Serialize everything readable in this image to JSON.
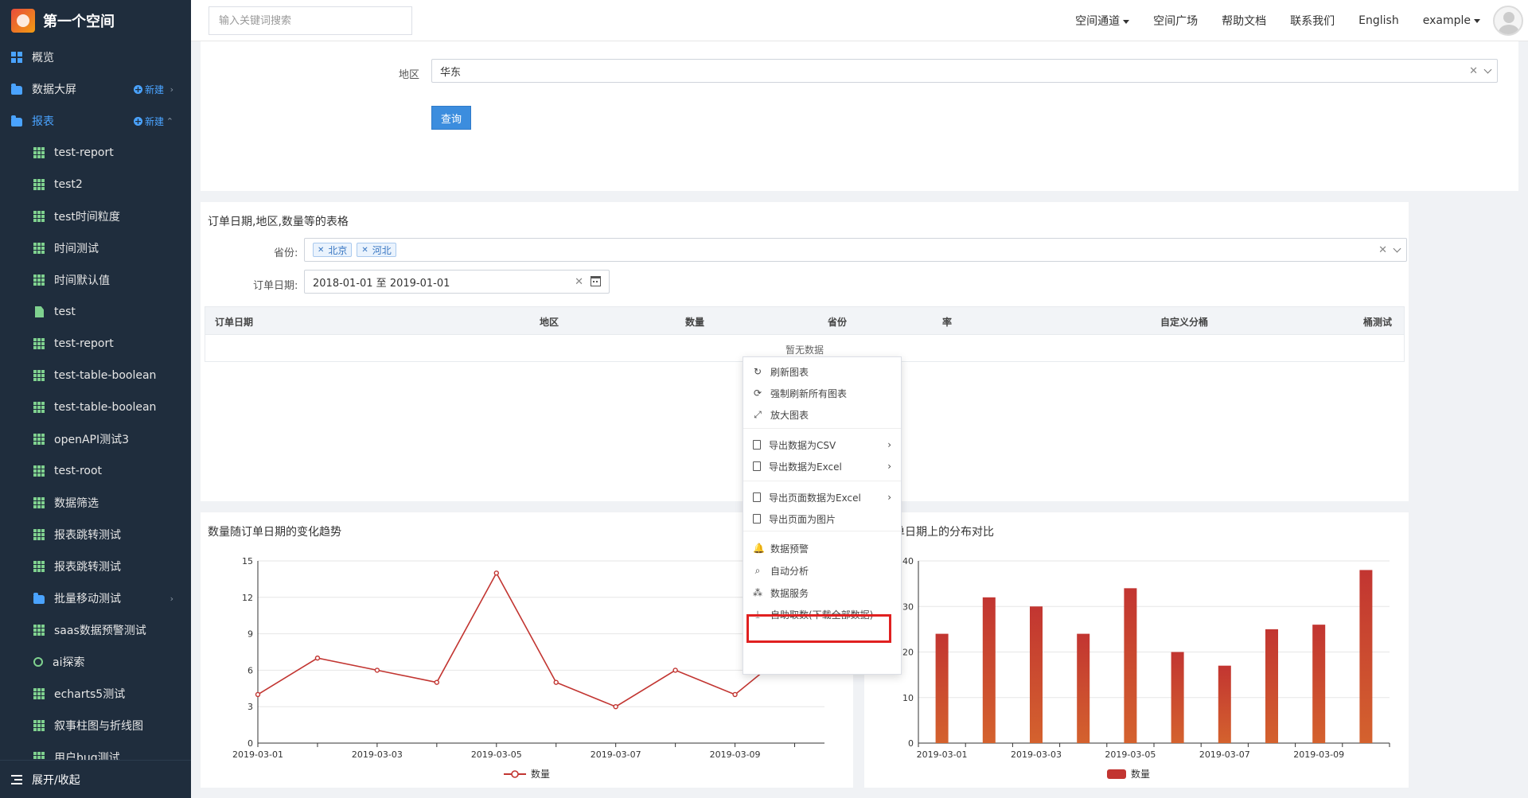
{
  "app": {
    "title": "第一个空间"
  },
  "sidebar": {
    "items": [
      {
        "label": "概览",
        "icon": "dashboard-icon",
        "level": 0
      },
      {
        "label": "数据大屏",
        "icon": "folder-icon",
        "level": 0,
        "new_label": "新建"
      },
      {
        "label": "报表",
        "icon": "folder-icon",
        "level": 0,
        "new_label": "新建",
        "active": true
      },
      {
        "label": "test-report",
        "icon": "table-icon",
        "level": 1
      },
      {
        "label": "test2",
        "icon": "table-icon",
        "level": 1
      },
      {
        "label": "test时间粒度",
        "icon": "table-icon",
        "level": 1
      },
      {
        "label": "时间测试",
        "icon": "table-icon",
        "level": 1
      },
      {
        "label": "时间默认值",
        "icon": "table-icon",
        "level": 1
      },
      {
        "label": "test",
        "icon": "file-icon",
        "level": 1
      },
      {
        "label": "test-report",
        "icon": "table-icon",
        "level": 1
      },
      {
        "label": "test-table-boolean",
        "icon": "table-icon",
        "level": 1
      },
      {
        "label": "test-table-boolean",
        "icon": "table-icon",
        "level": 1
      },
      {
        "label": "openAPI测试3",
        "icon": "table-icon",
        "level": 1
      },
      {
        "label": "test-root",
        "icon": "table-icon",
        "level": 1
      },
      {
        "label": "数据筛选",
        "icon": "table-icon",
        "level": 1
      },
      {
        "label": "报表跳转测试",
        "icon": "table-icon",
        "level": 1
      },
      {
        "label": "报表跳转测试",
        "icon": "table-icon",
        "level": 1
      },
      {
        "label": "批量移动测试",
        "icon": "folder-icon",
        "level": 1
      },
      {
        "label": "saas数据预警测试",
        "icon": "table-icon",
        "level": 1
      },
      {
        "label": "ai探索",
        "icon": "ai-icon",
        "level": 1
      },
      {
        "label": "echarts5测试",
        "icon": "table-icon",
        "level": 1
      },
      {
        "label": "叙事柱图与折线图",
        "icon": "table-icon",
        "level": 1
      },
      {
        "label": "用户bug测试",
        "icon": "table-icon",
        "level": 1
      }
    ],
    "footer_label": "展开/收起"
  },
  "topbar": {
    "search_placeholder": "输入关键词搜索",
    "nav": {
      "space_channel": "空间通道",
      "space_square": "空间广场",
      "help_docs": "帮助文档",
      "contact_us": "联系我们",
      "language": "English",
      "user": "example"
    }
  },
  "filter": {
    "region_label": "地区",
    "region_value": "华东",
    "query_label": "查询"
  },
  "table_card": {
    "title": "订单日期,地区,数量等的表格",
    "province_label": "省份:",
    "province_tags": [
      "北京",
      "河北"
    ],
    "date_label": "订单日期:",
    "date_value": "2018-01-01 至 2019-01-01",
    "columns": [
      "订单日期",
      "地区",
      "数量",
      "省份",
      "率",
      "自定义分桶",
      "桶测试"
    ],
    "empty_text": "暂无数据"
  },
  "context_menu": {
    "items": [
      {
        "label": "刷新图表",
        "icon": "refresh-icon"
      },
      {
        "label": "强制刷新所有图表",
        "icon": "sync-icon"
      },
      {
        "label": "放大图表",
        "icon": "expand-icon"
      },
      {
        "label": "导出数据为CSV",
        "icon": "file-csv-icon",
        "submenu": true
      },
      {
        "label": "导出数据为Excel",
        "icon": "file-excel-icon",
        "submenu": true
      },
      {
        "label": "导出页面数据为Excel",
        "icon": "file-excel-icon",
        "submenu": true
      },
      {
        "label": "导出页面为图片",
        "icon": "file-image-icon"
      },
      {
        "label": "数据预警",
        "icon": "bell-icon"
      },
      {
        "label": "自动分析",
        "icon": "search-icon"
      },
      {
        "label": "数据服务",
        "icon": "share-nodes-icon",
        "highlighted": true
      },
      {
        "label": "自助取数(下载全部数据)",
        "icon": "download-icon"
      }
    ]
  },
  "chart_data": [
    {
      "type": "line",
      "title": "数量随订单日期的变化趋势",
      "x": [
        "2019-03-01",
        "2019-03-02",
        "2019-03-03",
        "2019-03-04",
        "2019-03-05",
        "2019-03-06",
        "2019-03-07",
        "2019-03-08",
        "2019-03-09",
        "2019-03-10"
      ],
      "x_tick_labels": [
        "2019-03-01",
        "2019-03-03",
        "2019-03-05",
        "2019-03-07",
        "2019-03-09"
      ],
      "series": [
        {
          "name": "数量",
          "values": [
            4,
            7,
            6,
            5,
            14,
            5,
            3,
            6,
            4,
            8
          ]
        }
      ],
      "ylim": [
        0,
        15
      ],
      "yticks": [
        0,
        3,
        6,
        9,
        12,
        15
      ],
      "grid": true,
      "legend": "bottom-center",
      "color": "#c23531"
    },
    {
      "type": "bar",
      "title": "在订单日期上的分布对比",
      "categories": [
        "2019-03-01",
        "2019-03-02",
        "2019-03-03",
        "2019-03-04",
        "2019-03-05",
        "2019-03-06",
        "2019-03-07",
        "2019-03-08",
        "2019-03-09",
        "2019-03-10"
      ],
      "x_tick_labels": [
        "2019-03-01",
        "2019-03-03",
        "2019-03-05",
        "2019-03-07",
        "2019-03-09"
      ],
      "series": [
        {
          "name": "数量",
          "values": [
            24,
            32,
            30,
            24,
            34,
            20,
            17,
            25,
            26,
            38
          ]
        }
      ],
      "ylim": [
        0,
        40
      ],
      "yticks": [
        0,
        10,
        20,
        30,
        40
      ],
      "grid": true,
      "legend": "bottom-center",
      "color": "#c23531"
    }
  ]
}
